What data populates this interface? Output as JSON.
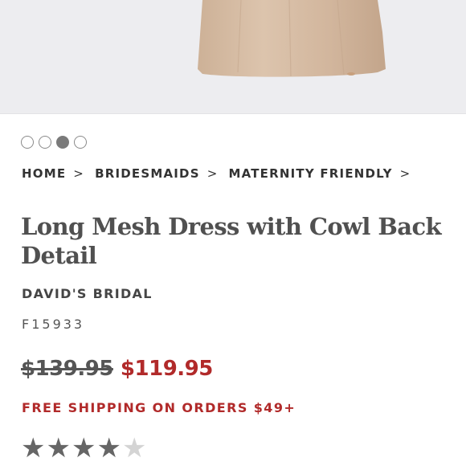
{
  "carousel": {
    "count": 4,
    "active_index": 2
  },
  "breadcrumb": {
    "items": [
      {
        "label": "HOME",
        "sep": ">"
      },
      {
        "label": "BRIDESMAIDS",
        "sep": ">"
      },
      {
        "label": "MATERNITY FRIENDLY",
        "sep": ">"
      }
    ]
  },
  "product": {
    "title": "Long Mesh Dress with Cowl Back Detail",
    "brand": "DAVID'S BRIDAL",
    "sku": "F15933",
    "price_original": "$139.95",
    "price_sale": "$119.95",
    "shipping_note": "FREE SHIPPING ON ORDERS $49+",
    "rating": 4,
    "rating_max": 5
  },
  "colors": {
    "accent_red": "#b12a2a",
    "text_gray": "#505050",
    "dress": "#d4b9a0"
  }
}
